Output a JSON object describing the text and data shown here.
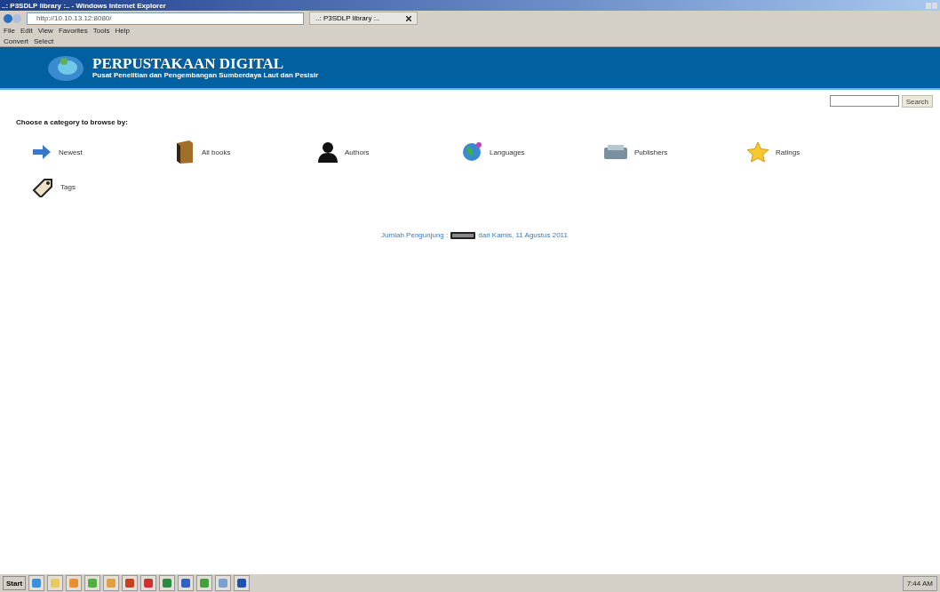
{
  "window": {
    "title": "..: P3SDLP library :.. - Windows Internet Explorer"
  },
  "browser": {
    "address": "http://10.10.13.12:8080/",
    "tab": "..: P3SDLP library :..",
    "menu": [
      "File",
      "Edit",
      "View",
      "Favorites",
      "Tools",
      "Help"
    ],
    "toolbar": [
      "Convert",
      "Select"
    ]
  },
  "header": {
    "title": "PERPUSTAKAAN DIGITAL",
    "subtitle": "Pusat Penelitian dan Pengembangan Sumberdaya Laut dan Pesisir"
  },
  "search": {
    "button": "Search"
  },
  "heading": "Choose a category to browse by:",
  "categories": [
    {
      "kind": "newest",
      "label": "Newest"
    },
    {
      "kind": "books",
      "label": "All books"
    },
    {
      "kind": "authors",
      "label": "Authors"
    },
    {
      "kind": "languages",
      "label": "Languages"
    },
    {
      "kind": "publishers",
      "label": "Publishers"
    },
    {
      "kind": "ratings",
      "label": "Ratings"
    },
    {
      "kind": "tags",
      "label": "Tags"
    }
  ],
  "footer": {
    "before": "Jumlah Pengunjung :",
    "after": "dari Kamis, 11 Agustus 2011"
  },
  "taskbar": {
    "start": "Start",
    "clock": "7:44 AM"
  }
}
